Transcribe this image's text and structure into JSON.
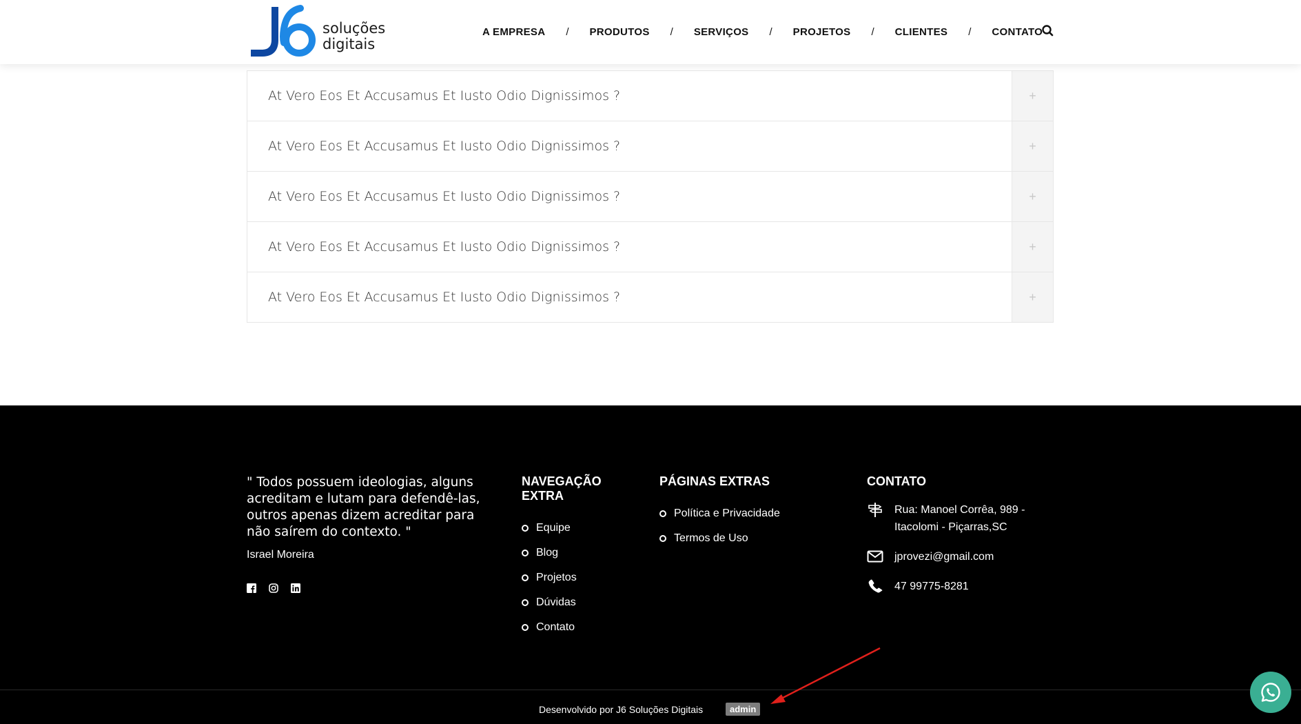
{
  "header": {
    "logo": {
      "mark": "J6",
      "line1": "soluções",
      "line2": "digitais"
    },
    "nav": [
      {
        "label": "A EMPRESA"
      },
      {
        "label": "PRODUTOS"
      },
      {
        "label": "SERVIÇOS"
      },
      {
        "label": "PROJETOS"
      },
      {
        "label": "CLIENTES"
      },
      {
        "label": "CONTATO"
      }
    ],
    "separator": "/",
    "search_icon": "search-icon"
  },
  "faq": {
    "items": [
      {
        "question": "At Vero Eos Et Accusamus Et Iusto Odio Dignissimos ?",
        "toggle": "+"
      },
      {
        "question": "At Vero Eos Et Accusamus Et Iusto Odio Dignissimos ?",
        "toggle": "+"
      },
      {
        "question": "At Vero Eos Et Accusamus Et Iusto Odio Dignissimos ?",
        "toggle": "+"
      },
      {
        "question": "At Vero Eos Et Accusamus Et Iusto Odio Dignissimos ?",
        "toggle": "+"
      },
      {
        "question": "At Vero Eos Et Accusamus Et Iusto Odio Dignissimos ?",
        "toggle": "+"
      }
    ]
  },
  "footer": {
    "quote": "\" Todos possuem ideologias, alguns acreditam e lutam para defendê-las, outros apenas dizem acreditar para não saírem do contexto. \"",
    "author": "Israel Moreira",
    "socials": [
      "facebook-icon",
      "instagram-icon",
      "linkedin-icon"
    ],
    "navigation": {
      "title": "NAVEGAÇÃO EXTRA",
      "links": [
        "Equipe",
        "Blog",
        "Projetos",
        "Dúvidas",
        "Contato"
      ]
    },
    "extra_pages": {
      "title": "PÁGINAS EXTRAS",
      "links": [
        "Política e Privacidade",
        "Termos de Uso"
      ]
    },
    "contact": {
      "title": "CONTATO",
      "address": "Rua: Manoel Corrêa, 989 - Itacolomi - Piçarras,SC",
      "email": "jprovezi@gmail.com",
      "phone": "47 99775-8281"
    },
    "credits": "Desenvolvido por J6 Soluções Digitais",
    "admin_badge": "admin"
  },
  "colors": {
    "logo_dark_blue": "#0d47a1",
    "logo_light_blue": "#1e88e5",
    "footer_bg": "#000000",
    "whatsapp_green": "#3aaf93",
    "annotation_arrow": "#e0201b"
  }
}
